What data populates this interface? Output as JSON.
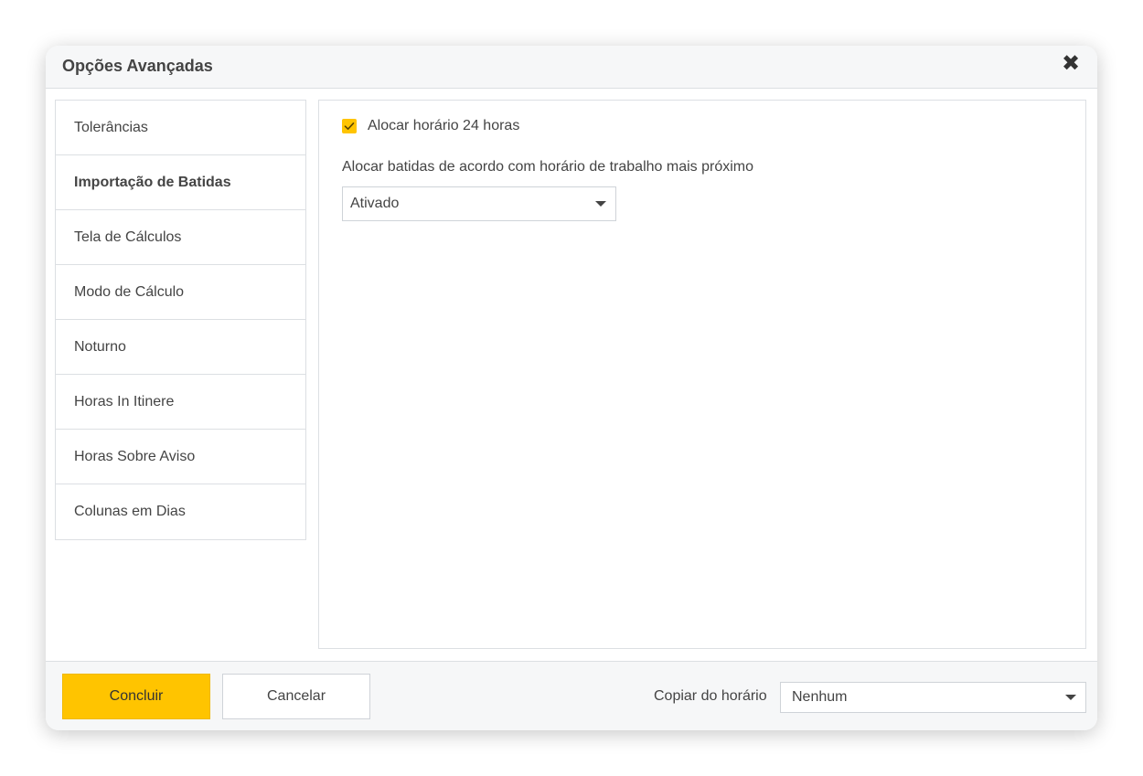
{
  "dialog": {
    "title": "Opções Avançadas",
    "close_icon": "close-icon"
  },
  "sidebar": {
    "items": [
      {
        "label": "Tolerâncias",
        "active": false
      },
      {
        "label": "Importação de Batidas",
        "active": true
      },
      {
        "label": "Tela de Cálculos",
        "active": false
      },
      {
        "label": "Modo de Cálculo",
        "active": false
      },
      {
        "label": "Noturno",
        "active": false
      },
      {
        "label": "Horas In Itinere",
        "active": false
      },
      {
        "label": "Horas Sobre Aviso",
        "active": false
      },
      {
        "label": "Colunas em Dias",
        "active": false
      }
    ]
  },
  "content": {
    "checkbox_label": "Alocar horário 24 horas",
    "checkbox_checked": true,
    "field_label": "Alocar batidas de acordo com horário de trabalho mais próximo",
    "select_value": "Ativado"
  },
  "footer": {
    "confirm_label": "Concluir",
    "cancel_label": "Cancelar",
    "copy_label": "Copiar do horário",
    "copy_value": "Nenhum"
  },
  "colors": {
    "accent": "#ffc400",
    "border": "#dcdfe3",
    "header_bg": "#f6f7f8",
    "text": "#444444"
  }
}
